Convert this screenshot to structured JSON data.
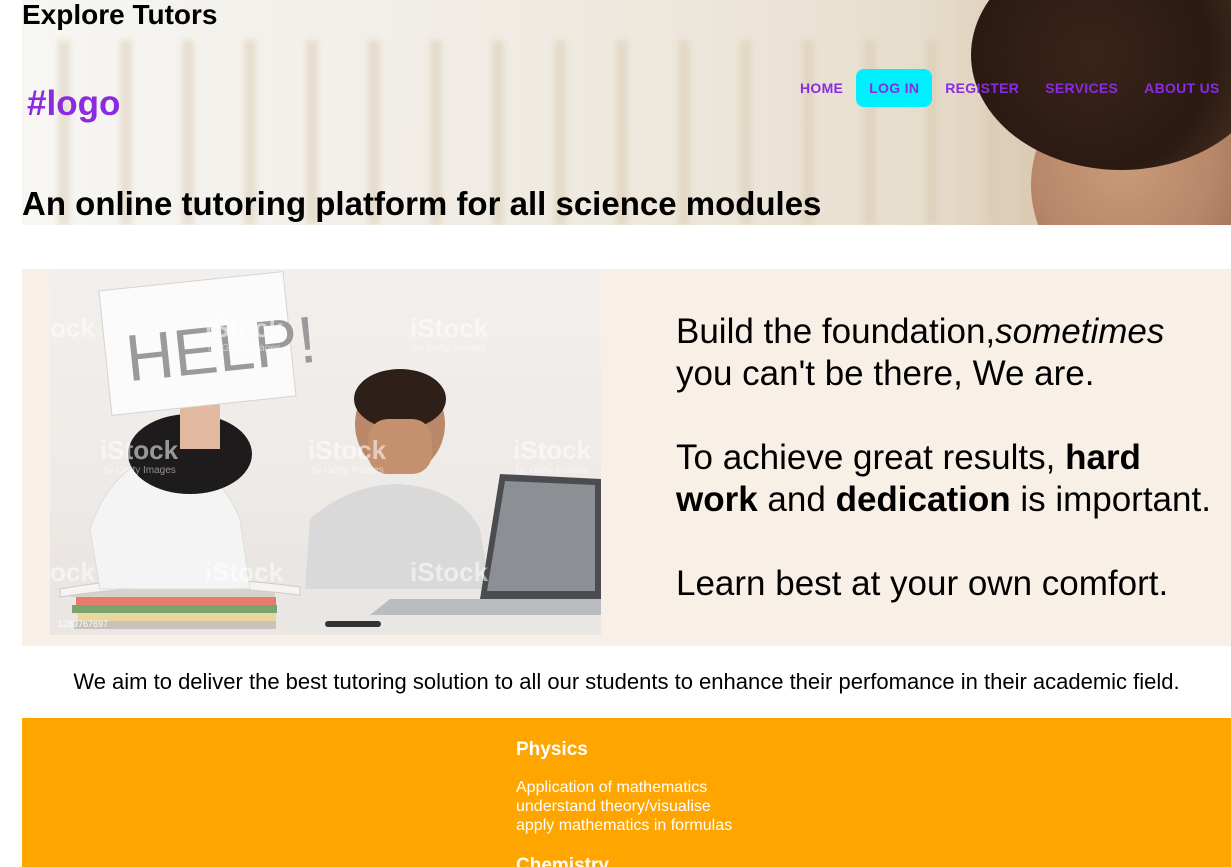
{
  "site": {
    "title": "Explore Tutors",
    "logo": "#logo",
    "tagline": "An online tutoring platform for all science modules"
  },
  "nav": {
    "items": [
      {
        "label": "HOME",
        "active": false
      },
      {
        "label": "LOG IN",
        "active": true
      },
      {
        "label": "REGISTER",
        "active": false
      },
      {
        "label": "SERVICES",
        "active": false
      },
      {
        "label": "ABOUT US",
        "active": false
      }
    ]
  },
  "feature": {
    "image": {
      "sign_text": "HELP!",
      "watermark": "iStock",
      "watermark_sub": "by Getty Images",
      "stock_id": "1289767697"
    },
    "para1": {
      "normal": "Build the foundation,",
      "italic": "sometimes",
      "rest": " you can't be there, We are."
    },
    "para2": {
      "part1": "To achieve great results, ",
      "bold1": "hard work",
      "part2": " and ",
      "bold2": "dedication",
      "part3": " is important."
    },
    "para3": "Learn best at your own comfort."
  },
  "mission": "We aim to deliver the best tutoring solution to all our students to enhance their perfomance in their academic field.",
  "subjects": [
    {
      "name": "Physics",
      "points": [
        "Application of mathematics",
        "understand theory/visualise",
        "apply mathematics in formulas"
      ]
    },
    {
      "name": "Chemistry",
      "points": []
    }
  ],
  "colors": {
    "accent": "#8a2be2",
    "active_nav_bg": "#00f0ff",
    "feature_bg": "#f8f0e6",
    "subjects_bg": "#ffa500"
  }
}
